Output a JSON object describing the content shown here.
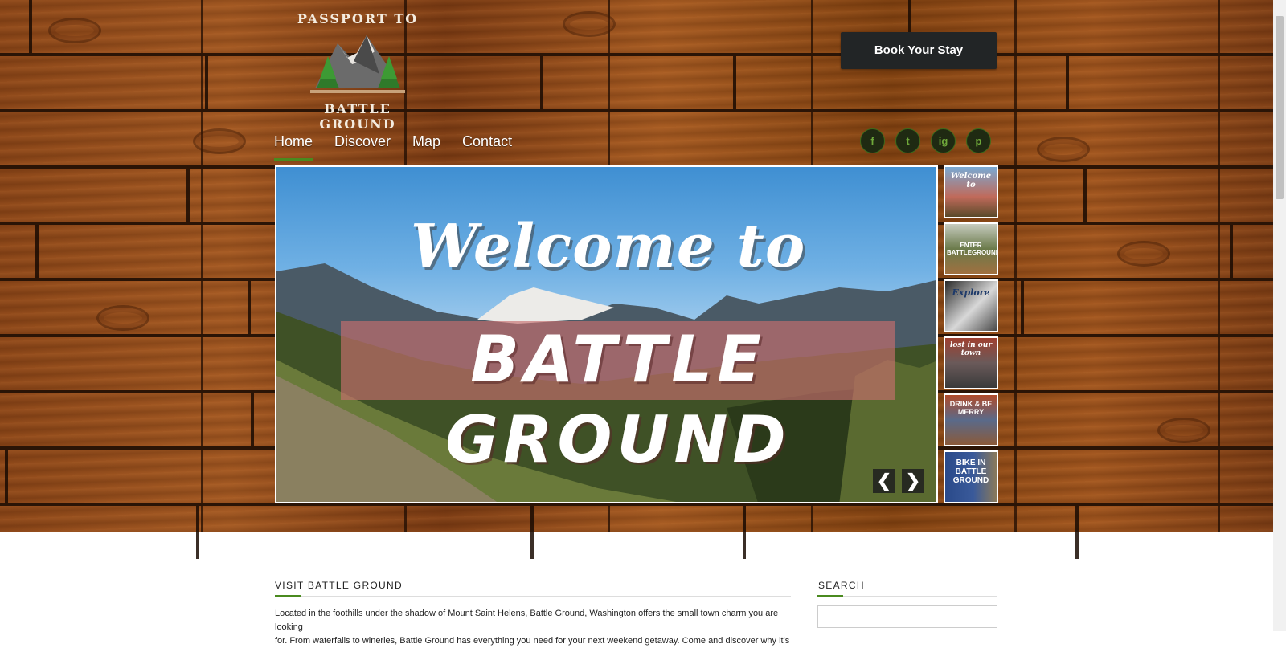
{
  "logo": {
    "top_text": "PASSPORT TO",
    "bottom_text": "BATTLE GROUND"
  },
  "header": {
    "book_label": "Book Your Stay"
  },
  "nav": {
    "items": [
      "Home",
      "Discover",
      "Map",
      "Contact"
    ],
    "active": "Home"
  },
  "social": {
    "items": [
      "f",
      "t",
      "ig",
      "p"
    ]
  },
  "slider": {
    "welcome": "Welcome to",
    "title": "BATTLE GROUND",
    "prev_icon": "chevron-left-icon",
    "next_icon": "chevron-right-icon",
    "prev_glyph": "❮",
    "next_glyph": "❯"
  },
  "thumbnails": [
    "Welcome to",
    "ENTER BATTLEGROUND",
    "Explore",
    "lost in our town",
    "DRINK & BE MERRY",
    "BIKE IN BATTLE GROUND"
  ],
  "content": {
    "section_title": "VISIT BATTLE GROUND",
    "intro_line1": "Located in the foothills under the shadow of Mount Saint Helens, Battle Ground, Washington offers the small town charm you are looking",
    "intro_line2": "for. From waterfalls to wineries, Battle Ground has everything you need for your next weekend getaway. Come and discover why it's"
  },
  "sidebar": {
    "search_title": "SEARCH",
    "search_placeholder": ""
  },
  "colors": {
    "accent": "#4a8a1f",
    "button_bg": "#222526",
    "wood": "#8a4416"
  }
}
